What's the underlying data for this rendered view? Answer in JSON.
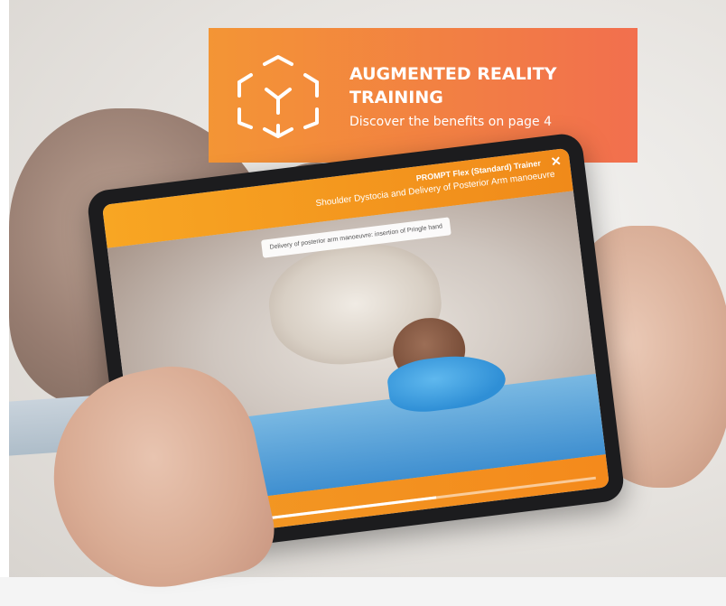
{
  "banner": {
    "title": "AUGMENTED REALITY TRAINING",
    "subtitle": "Discover the benefits on page 4",
    "icon": "ar-cube-icon",
    "colors": {
      "start": "#f39535",
      "end": "#f26f4e"
    }
  },
  "app": {
    "title": "PROMPT Flex (Standard) Trainer",
    "subtitle": "Shoulder Dystocia and Delivery of Posterior Arm manoeuvre",
    "close": "✕",
    "step_label": "Delivery of posterior arm manoeuvre: insertion of Pringle hand",
    "controls": {
      "prev": "⏮",
      "play": "▶",
      "next": "⏭"
    },
    "progress": 0.55
  }
}
